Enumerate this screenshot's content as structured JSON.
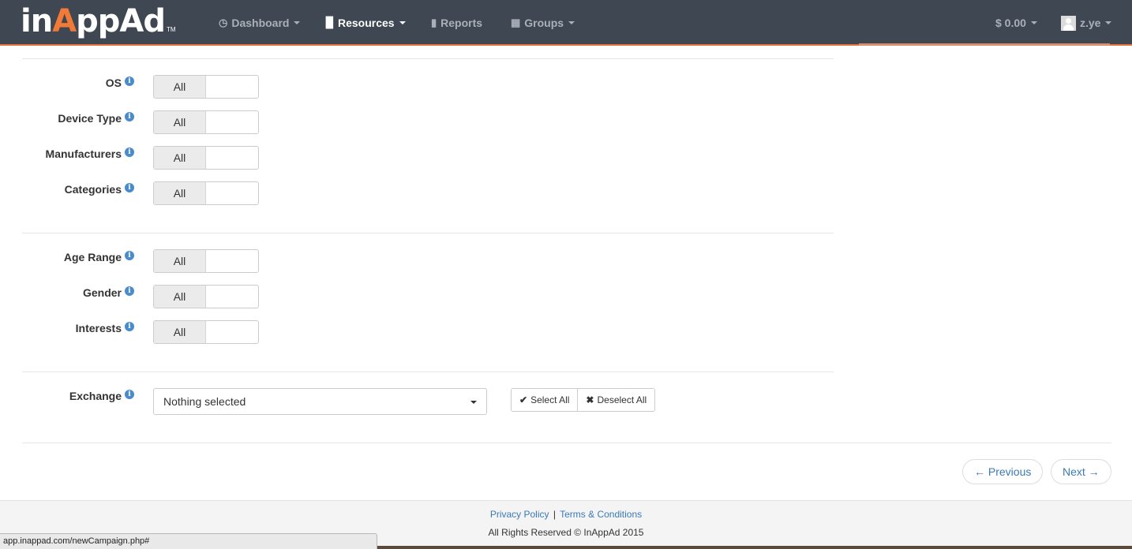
{
  "brand": {
    "pre": "in",
    "accent": "A",
    "post": "ppAd",
    "tm": "TM"
  },
  "nav": {
    "dashboard": "Dashboard",
    "resources": "Resources",
    "reports": "Reports",
    "groups": "Groups",
    "balance": "$ 0.00",
    "user": "z.ye"
  },
  "targeting": {
    "os": {
      "label": "OS",
      "value": "All"
    },
    "device_type": {
      "label": "Device Type",
      "value": "All"
    },
    "manufacturers": {
      "label": "Manufacturers",
      "value": "All"
    },
    "categories": {
      "label": "Categories",
      "value": "All"
    },
    "age_range": {
      "label": "Age Range",
      "value": "All"
    },
    "gender": {
      "label": "Gender",
      "value": "All"
    },
    "interests": {
      "label": "Interests",
      "value": "All"
    }
  },
  "exchange": {
    "label": "Exchange",
    "selected": "Nothing selected",
    "select_all": "Select All",
    "deselect_all": "Deselect All"
  },
  "pager": {
    "previous": "← Previous",
    "next": "Next →"
  },
  "footer": {
    "privacy": "Privacy Policy",
    "separator": "|",
    "terms": "Terms & Conditions",
    "copyright": "All Rights Reserved © InAppAd 2015"
  },
  "status_url": "app.inappad.com/newCampaign.php#",
  "colors": {
    "navbar": "#3f4752",
    "accent": "#f07a36",
    "link": "#3b79b7",
    "info": "#4a8ccb"
  }
}
